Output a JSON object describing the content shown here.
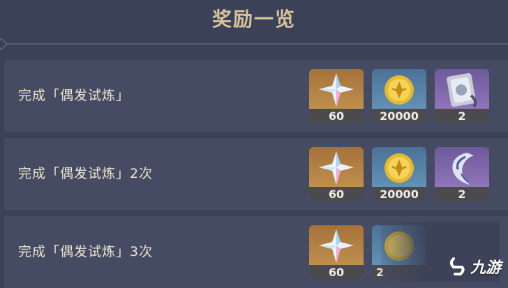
{
  "header": {
    "title": "奖励一览"
  },
  "rows": [
    {
      "label": "完成「偶发试炼」",
      "rewards": [
        {
          "icon": "primogem-icon",
          "qty": "60"
        },
        {
          "icon": "mora-icon",
          "qty": "20000"
        },
        {
          "icon": "talent-book-icon",
          "qty": "2"
        }
      ]
    },
    {
      "label": "完成「偶发试炼」2次",
      "rewards": [
        {
          "icon": "primogem-icon",
          "qty": "60"
        },
        {
          "icon": "mora-icon",
          "qty": "20000"
        },
        {
          "icon": "horn-material-icon",
          "qty": "2"
        }
      ]
    },
    {
      "label": "完成「偶发试炼」3次",
      "rewards": [
        {
          "icon": "primogem-icon",
          "qty": "60"
        },
        {
          "icon": "mora-icon",
          "qty": "2"
        }
      ]
    }
  ],
  "watermark": {
    "text": "九游"
  },
  "colors": {
    "background": "#3b4157",
    "row": "#454b63",
    "title": "#d7c39b",
    "label": "#ece4d0"
  }
}
